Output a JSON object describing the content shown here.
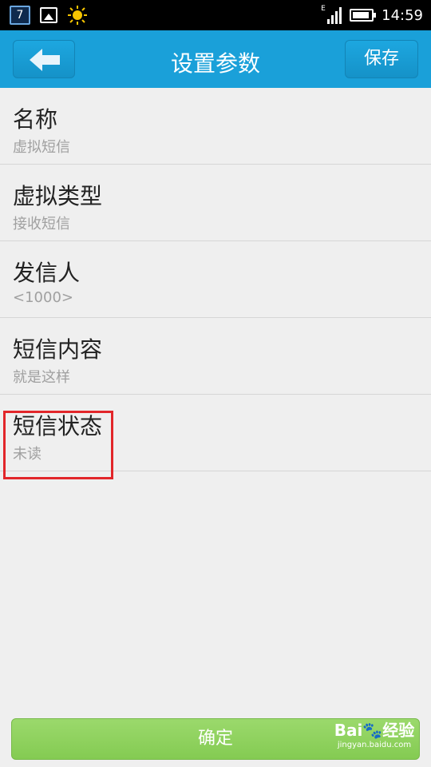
{
  "status_bar": {
    "calendar_day": "7",
    "network_type": "E",
    "time": "14:59",
    "icons": [
      "calendar-icon",
      "gallery-icon",
      "brightness-icon",
      "signal-icon",
      "battery-icon"
    ]
  },
  "header": {
    "title": "设置参数",
    "save_label": "保存",
    "back_icon": "back-arrow-icon"
  },
  "settings": [
    {
      "title": "名称",
      "value": "虚拟短信"
    },
    {
      "title": "虚拟类型",
      "value": "接收短信"
    },
    {
      "title": "发信人",
      "value": "<1000>"
    },
    {
      "title": "短信内容",
      "value": "就是这样"
    },
    {
      "title": "短信状态",
      "value": "未读"
    }
  ],
  "footer": {
    "confirm_label": "确定"
  },
  "watermark": {
    "logo": "Bai🐾经验",
    "site": "jingyan.baidu.com"
  },
  "colors": {
    "header_bg": "#1aa0d9",
    "confirm_bg": "#8bd05a",
    "highlight": "#e2262a",
    "background": "#efefef"
  }
}
